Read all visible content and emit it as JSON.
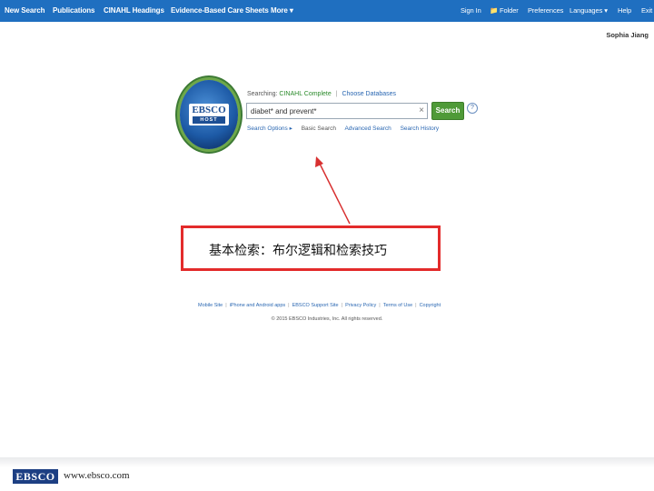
{
  "nav": {
    "left": [
      "New Search",
      "Publications",
      "CINAHL Headings",
      "Evidence-Based Care Sheets",
      "More ▾"
    ],
    "right": [
      "Sign In",
      "Folder",
      "Preferences",
      "Languages ▾",
      "Help",
      "Exit"
    ]
  },
  "user": {
    "name": "Sophia Jiang"
  },
  "logo": {
    "top": "EBSCO",
    "bottom": "HOST"
  },
  "search": {
    "searching_label": "Searching:",
    "database": "CINAHL Complete",
    "choose_databases": "Choose Databases",
    "query": "diabet* and prevent*",
    "button": "Search",
    "help": "?",
    "options": "Search Options ▸",
    "basic": "Basic Search",
    "advanced": "Advanced Search",
    "history": "Search History"
  },
  "annotation": {
    "text": "基本检索：布尔逻辑和检索技巧"
  },
  "footer": {
    "links": [
      "Mobile Site",
      "iPhone and Android apps",
      "EBSCO Support Site",
      "Privacy Policy",
      "Terms of Use",
      "Copyright"
    ],
    "copyright": "© 2015 EBSCO Industries, Inc. All rights reserved."
  },
  "brand": {
    "logo": "EBSCO",
    "url": "www.ebsco.com"
  },
  "colors": {
    "nav_bg": "#1f6fc0",
    "search_btn": "#4f9a38",
    "annotation": "#e32b2b"
  }
}
